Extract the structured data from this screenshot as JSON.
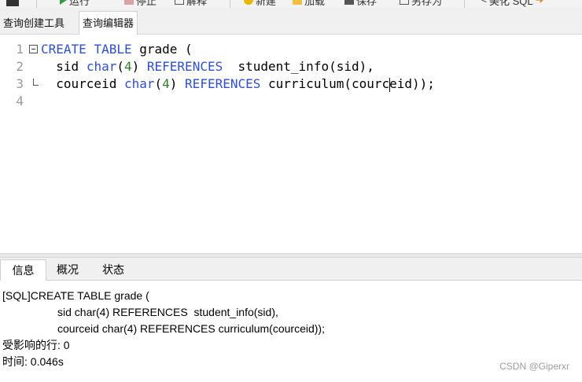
{
  "toolbar": {
    "items": [
      "运行",
      "停止",
      "解释",
      "新建",
      "加载",
      "保存",
      "另存为",
      "美化 SQL"
    ]
  },
  "tabs": {
    "query_builder": "查询创建工具",
    "query_editor": "查询编辑器"
  },
  "editor": {
    "lines": [
      {
        "number": "1",
        "text": "CREATE TABLE grade ("
      },
      {
        "number": "2",
        "text": "sid char(4) REFERENCES  student_info(sid),"
      },
      {
        "number": "3",
        "text": "courceid char(4) REFERENCES curriculum(courceid));"
      },
      {
        "number": "4",
        "text": ""
      }
    ]
  },
  "bottom_tabs": {
    "info": "信息",
    "overview": "概况",
    "status": "状态"
  },
  "messages": {
    "line1": "[SQL]CREATE TABLE grade (",
    "line2": "sid char(4) REFERENCES  student_info(sid),",
    "line3": "courceid char(4) REFERENCES curriculum(courceid));",
    "affected": "受影响的行: 0",
    "time": "时间: 0.046s"
  },
  "watermark": "CSDN @Giperxr",
  "colors": {
    "keyword": "#2f4fd2",
    "number": "#2f7d2f",
    "line_number": "#9a9a9a"
  }
}
